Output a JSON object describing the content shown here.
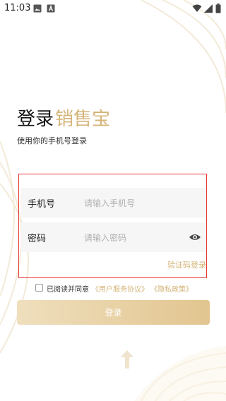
{
  "status_bar": {
    "time": "11:03",
    "left_icons": [
      "image-icon",
      "a-badge-icon"
    ],
    "right_icons": [
      "wifi-icon",
      "cell-signal-icon",
      "battery-icon"
    ]
  },
  "header": {
    "title_main": "登录",
    "title_brand": "销售宝",
    "subtitle": "使用你的手机号登录"
  },
  "form": {
    "phone": {
      "label": "手机号",
      "placeholder": "请输入手机号",
      "value": ""
    },
    "password": {
      "label": "密码",
      "placeholder": "请输入密码",
      "value": ""
    },
    "sms_login_label": "验证码登录"
  },
  "agreement": {
    "checked": false,
    "text": "已阅读并同意",
    "user_agreement": "《用户服务协议》",
    "privacy_policy": "《隐私政策》"
  },
  "login_button_label": "登录",
  "colors": {
    "brand_gold": "#d4b478",
    "button_start": "#efdfbd",
    "button_end": "#e2c590",
    "input_bg": "#f6f6f6",
    "highlight_border": "#e53935"
  }
}
